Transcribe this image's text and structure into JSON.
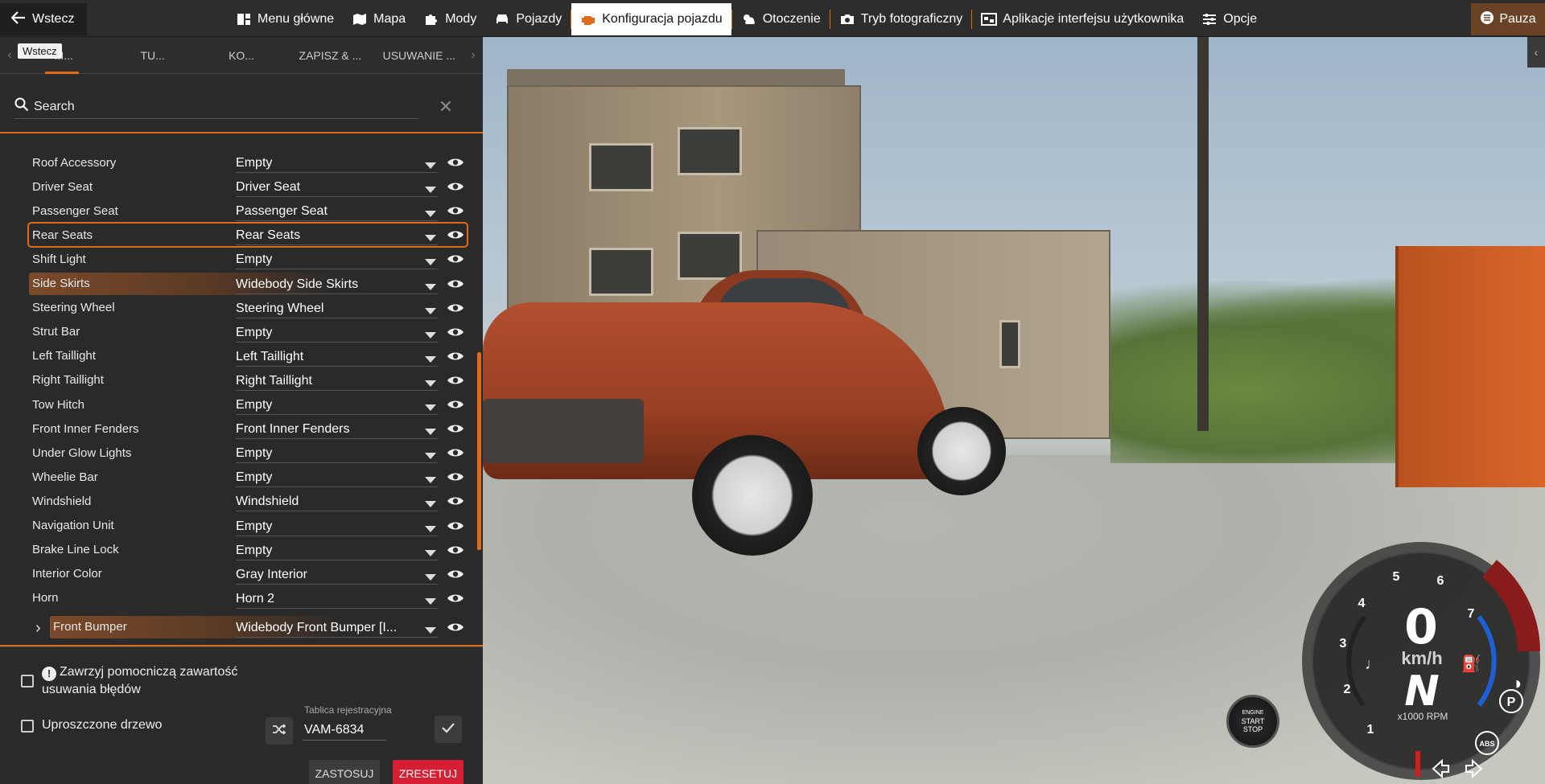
{
  "topbar": {
    "back_label": "Wstecz",
    "nav": [
      {
        "label": "Menu główne",
        "icon": "main-menu-icon"
      },
      {
        "label": "Mapa",
        "icon": "map-icon"
      },
      {
        "label": "Mody",
        "icon": "puzzle-icon"
      },
      {
        "label": "Pojazdy",
        "icon": "car-icon"
      },
      {
        "label": "Konfiguracja pojazdu",
        "icon": "engine-icon",
        "active": true
      },
      {
        "label": "Otoczenie",
        "icon": "weather-icon"
      },
      {
        "label": "Tryb fotograficzny",
        "icon": "camera-icon"
      },
      {
        "label": "Aplikacje interfejsu użytkownika",
        "icon": "ui-apps-icon"
      },
      {
        "label": "Opcje",
        "icon": "sliders-icon"
      }
    ],
    "pause_label": "Pauza"
  },
  "panel": {
    "tooltip": "Wstecz",
    "tabs": [
      "M...",
      "TU...",
      "KO...",
      "ZAPISZ & ...",
      "USUWANIE ..."
    ],
    "search": {
      "placeholder": "Search",
      "value": "Search"
    },
    "rows": [
      {
        "label": "Roof Accessory",
        "value": "Empty"
      },
      {
        "label": "Driver Seat",
        "value": "Driver Seat"
      },
      {
        "label": "Passenger Seat",
        "value": "Passenger Seat"
      },
      {
        "label": "Rear Seats",
        "value": "Rear Seats",
        "state": "focused"
      },
      {
        "label": "Shift Light",
        "value": "Empty"
      },
      {
        "label": "Side Skirts",
        "value": "Widebody Side Skirts",
        "state": "highlighted"
      },
      {
        "label": "Steering Wheel",
        "value": "Steering Wheel"
      },
      {
        "label": "Strut Bar",
        "value": "Empty"
      },
      {
        "label": "Left Taillight",
        "value": "Left Taillight"
      },
      {
        "label": "Right Taillight",
        "value": "Right Taillight"
      },
      {
        "label": "Tow Hitch",
        "value": "Empty"
      },
      {
        "label": "Front Inner Fenders",
        "value": "Front Inner Fenders"
      },
      {
        "label": "Under Glow Lights",
        "value": "Empty"
      },
      {
        "label": "Wheelie Bar",
        "value": "Empty"
      },
      {
        "label": "Windshield",
        "value": "Windshield"
      },
      {
        "label": "Navigation Unit",
        "value": "Empty"
      },
      {
        "label": "Brake Line Lock",
        "value": "Empty"
      },
      {
        "label": "Interior Color",
        "value": "Gray Interior"
      },
      {
        "label": "Horn",
        "value": "Horn 2"
      },
      {
        "label": "Front Bumper",
        "value": "Widebody Front Bumper [I...",
        "state": "highlighted-expandable"
      }
    ],
    "options": {
      "debug_label": "Zawrzyj pomocniczą zawartość usuwania błędów",
      "simple_tree_label": "Uproszczone drzewo",
      "plate_label": "Tablica rejestracyjna",
      "plate_value": "VAM-6834"
    },
    "buttons": {
      "apply": "ZASTOSUJ",
      "reset": "ZRESETUJ"
    }
  },
  "hud": {
    "speed": "0",
    "speed_unit": "km/h",
    "gear": "N",
    "rpm_label": "x1000 RPM",
    "rpm_ticks": [
      "1",
      "2",
      "3",
      "4",
      "5",
      "6",
      "7"
    ],
    "engine_button": [
      "ENGINE",
      "START",
      "STOP"
    ],
    "indicators": [
      "P",
      "ABS"
    ]
  },
  "colors": {
    "accent": "#e06a1a",
    "reset": "#d71f33",
    "panel": "#2a2a2a"
  }
}
